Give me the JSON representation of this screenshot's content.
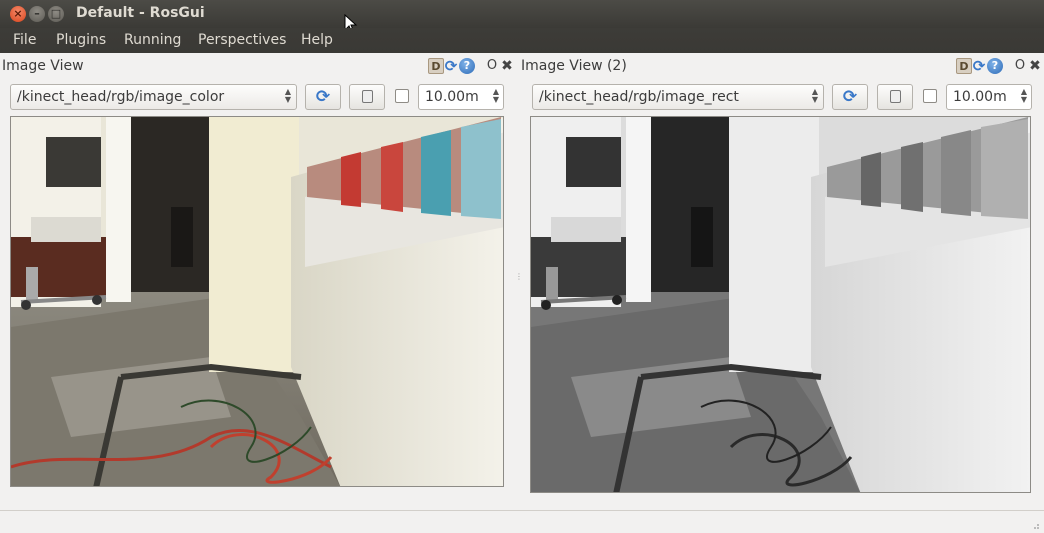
{
  "window": {
    "title": "Default - RosGui"
  },
  "menubar": {
    "items": [
      "File",
      "Plugins",
      "Running",
      "Perspectives",
      "Help"
    ]
  },
  "panels": [
    {
      "title": "Image View",
      "topic": "/kinect_head/rgb/image_color",
      "zoom_value": "10.00m",
      "checkbox_checked": false,
      "color_mode": "color"
    },
    {
      "title": "Image View (2)",
      "topic": "/kinect_head/rgb/image_rect",
      "zoom_value": "10.00m",
      "checkbox_checked": false,
      "color_mode": "grayscale"
    }
  ],
  "icons": {
    "title_d": "D",
    "help": "?",
    "undock": "O",
    "close": "✖"
  }
}
